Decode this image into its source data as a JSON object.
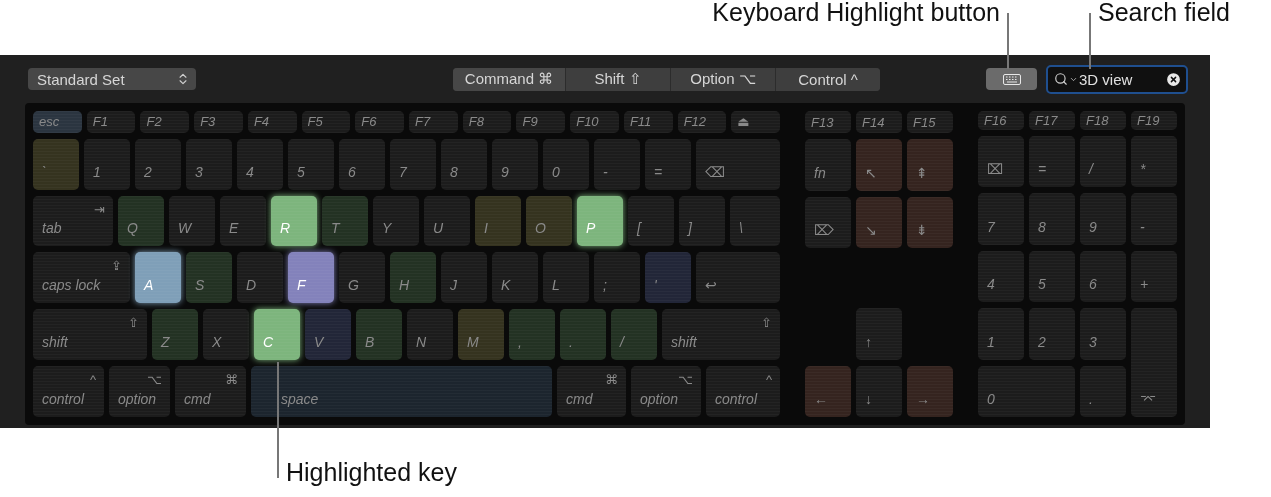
{
  "callouts": {
    "highlight_button": "Keyboard Highlight button",
    "search_field": "Search field",
    "highlighted_key": "Highlighted key"
  },
  "toolbar": {
    "command_set": "Standard Set",
    "modifiers": [
      "Command ⌘",
      "Shift ⇧",
      "Option ⌥",
      "Control ^"
    ],
    "highlight_button": {
      "on": true
    },
    "search": {
      "value": "3D view"
    }
  },
  "keyboard": {
    "main_rows": [
      [
        {
          "label": "esc",
          "color": "#2b3540",
          "highlighted": false
        },
        {
          "label": "F1",
          "highlighted": false
        },
        {
          "label": "F2",
          "highlighted": false
        },
        {
          "label": "F3",
          "highlighted": false
        },
        {
          "label": "F4",
          "highlighted": false
        },
        {
          "label": "F5",
          "highlighted": false
        },
        {
          "label": "F6",
          "highlighted": false
        },
        {
          "label": "F7",
          "highlighted": false
        },
        {
          "label": "F8",
          "highlighted": false
        },
        {
          "label": "F9",
          "highlighted": false
        },
        {
          "label": "F10",
          "highlighted": false
        },
        {
          "label": "F11",
          "highlighted": false
        },
        {
          "label": "F12",
          "highlighted": false
        },
        {
          "label": "⏏",
          "highlighted": false
        }
      ],
      [
        {
          "label": "`",
          "color": "#35331f",
          "highlighted": false
        },
        {
          "label": "1",
          "highlighted": false
        },
        {
          "label": "2",
          "highlighted": false
        },
        {
          "label": "3",
          "highlighted": false
        },
        {
          "label": "4",
          "highlighted": false
        },
        {
          "label": "5",
          "highlighted": false
        },
        {
          "label": "6",
          "highlighted": false
        },
        {
          "label": "7",
          "highlighted": false
        },
        {
          "label": "8",
          "highlighted": false
        },
        {
          "label": "9",
          "highlighted": false
        },
        {
          "label": "0",
          "highlighted": false
        },
        {
          "label": "-",
          "highlighted": false
        },
        {
          "label": "=",
          "highlighted": false
        },
        {
          "label": "⌫",
          "highlighted": false
        }
      ],
      [
        {
          "label": "tab",
          "symbol": "⇥",
          "highlighted": false
        },
        {
          "label": "Q",
          "color": "#233223",
          "highlighted": false
        },
        {
          "label": "W",
          "highlighted": false
        },
        {
          "label": "E",
          "highlighted": false
        },
        {
          "label": "R",
          "color": "#7db57d",
          "highlighted": true
        },
        {
          "label": "T",
          "color": "#233223",
          "highlighted": false
        },
        {
          "label": "Y",
          "highlighted": false
        },
        {
          "label": "U",
          "highlighted": false
        },
        {
          "label": "I",
          "color": "#35331f",
          "highlighted": false
        },
        {
          "label": "O",
          "color": "#35331f",
          "highlighted": false
        },
        {
          "label": "P",
          "color": "#7db57d",
          "highlighted": true
        },
        {
          "label": "[",
          "highlighted": false
        },
        {
          "label": "]",
          "highlighted": false
        },
        {
          "label": "\\",
          "highlighted": false
        }
      ],
      [
        {
          "label": "caps lock",
          "symbol": "⇪",
          "highlighted": false
        },
        {
          "label": "A",
          "color": "#7f9fb8",
          "highlighted": true
        },
        {
          "label": "S",
          "color": "#233223",
          "highlighted": false
        },
        {
          "label": "D",
          "highlighted": false
        },
        {
          "label": "F",
          "color": "#8382bb",
          "highlighted": true
        },
        {
          "label": "G",
          "highlighted": false
        },
        {
          "label": "H",
          "color": "#233223",
          "highlighted": false
        },
        {
          "label": "J",
          "highlighted": false
        },
        {
          "label": "K",
          "highlighted": false
        },
        {
          "label": "L",
          "highlighted": false
        },
        {
          "label": ";",
          "highlighted": false
        },
        {
          "label": "'",
          "color": "#222638",
          "highlighted": false
        },
        {
          "label": "↩",
          "highlighted": false
        }
      ],
      [
        {
          "label": "shift",
          "symbol": "⇧",
          "highlighted": false
        },
        {
          "label": "Z",
          "color": "#233223",
          "highlighted": false
        },
        {
          "label": "X",
          "highlighted": false
        },
        {
          "label": "C",
          "color": "#7db57d",
          "highlighted": true
        },
        {
          "label": "V",
          "color": "#222638",
          "highlighted": false
        },
        {
          "label": "B",
          "color": "#233223",
          "highlighted": false
        },
        {
          "label": "N",
          "highlighted": false
        },
        {
          "label": "M",
          "color": "#35331f",
          "highlighted": false
        },
        {
          "label": ",",
          "color": "#233223",
          "highlighted": false
        },
        {
          "label": ".",
          "color": "#233223",
          "highlighted": false
        },
        {
          "label": "/",
          "color": "#233223",
          "highlighted": false
        },
        {
          "label": "shift",
          "symbol": "⇧",
          "highlighted": false
        }
      ],
      [
        {
          "label": "control",
          "symbol": "^",
          "highlighted": false
        },
        {
          "label": "option",
          "symbol": "⌥",
          "highlighted": false
        },
        {
          "label": "cmd",
          "symbol": "⌘",
          "highlighted": false
        },
        {
          "label": "space",
          "color": "#1c252e",
          "highlighted": false
        },
        {
          "label": "cmd",
          "symbol": "⌘",
          "highlighted": false
        },
        {
          "label": "option",
          "symbol": "⌥",
          "highlighted": false
        },
        {
          "label": "control",
          "symbol": "^",
          "highlighted": false
        }
      ]
    ],
    "nav": {
      "function_keys": [
        {
          "label": "F13",
          "highlighted": false
        },
        {
          "label": "F14",
          "highlighted": false
        },
        {
          "label": "F15",
          "highlighted": false
        }
      ],
      "edit_rows": [
        [
          {
            "label": "fn",
            "highlighted": false
          },
          {
            "label": "↖",
            "color": "#35241f",
            "highlighted": false
          },
          {
            "label": "⇞",
            "color": "#35241f",
            "highlighted": false
          }
        ],
        [
          {
            "label": "⌦",
            "highlighted": false
          },
          {
            "label": "↘",
            "color": "#35241f",
            "highlighted": false
          },
          {
            "label": "⇟",
            "color": "#35241f",
            "highlighted": false
          }
        ]
      ],
      "arrow_keys": [
        {
          "label": "↑",
          "highlighted": false
        },
        {
          "label": "←",
          "color": "#35241f",
          "highlighted": false
        },
        {
          "label": "↓",
          "highlighted": false
        },
        {
          "label": "→",
          "color": "#35241f",
          "highlighted": false
        }
      ]
    },
    "numpad": {
      "function_keys": [
        {
          "label": "F16",
          "highlighted": false
        },
        {
          "label": "F17",
          "highlighted": false
        },
        {
          "label": "F18",
          "highlighted": false
        },
        {
          "label": "F19",
          "highlighted": false
        }
      ],
      "keys": [
        {
          "label": "⌧",
          "highlighted": false
        },
        {
          "label": "=",
          "highlighted": false
        },
        {
          "label": "/",
          "highlighted": false
        },
        {
          "label": "*",
          "highlighted": false
        },
        {
          "label": "7",
          "highlighted": false
        },
        {
          "label": "8",
          "highlighted": false
        },
        {
          "label": "9",
          "highlighted": false
        },
        {
          "label": "-",
          "highlighted": false
        },
        {
          "label": "4",
          "highlighted": false
        },
        {
          "label": "5",
          "highlighted": false
        },
        {
          "label": "6",
          "highlighted": false
        },
        {
          "label": "+",
          "highlighted": false
        },
        {
          "label": "1",
          "highlighted": false
        },
        {
          "label": "2",
          "highlighted": false
        },
        {
          "label": "3",
          "highlighted": false
        },
        {
          "label": "0",
          "highlighted": false
        },
        {
          "label": ".",
          "highlighted": false
        },
        {
          "label": "⌤",
          "highlighted": false
        }
      ]
    }
  }
}
